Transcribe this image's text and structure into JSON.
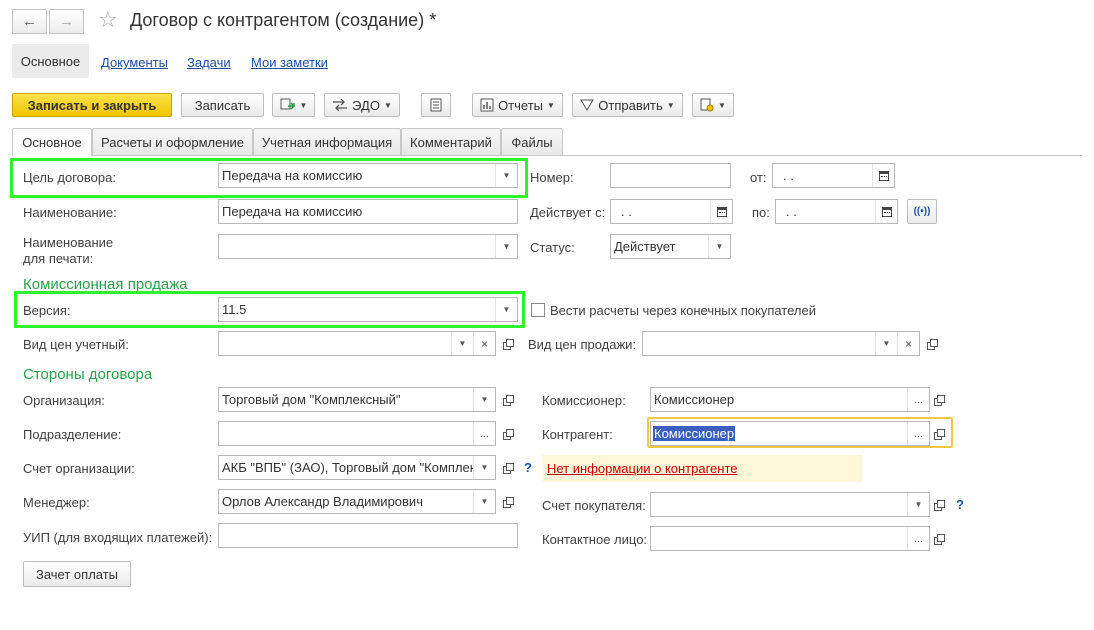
{
  "window": {
    "title": "Договор с контрагентом (создание) *"
  },
  "topnav": {
    "main": "Основное",
    "documents": "Документы",
    "tasks": "Задачи",
    "notes": "Мои заметки"
  },
  "toolbar": {
    "save_close": "Записать и закрыть",
    "save": "Записать",
    "edo": "ЭДО",
    "reports": "Отчеты",
    "send": "Отправить"
  },
  "tabs": [
    "Основное",
    "Расчеты и оформление",
    "Учетная информация",
    "Комментарий",
    "Файлы"
  ],
  "form": {
    "purpose_label": "Цель договора:",
    "purpose_value": "Передача на комиссию",
    "name_label": "Наименование:",
    "name_value": "Передача на комиссию",
    "print_name_label_1": "Наименование",
    "print_name_label_2": "для печати:",
    "print_name_value": "",
    "number_label": "Номер:",
    "number_value": "",
    "from_label": "от:",
    "from_value": " .  .",
    "valid_label": "Действует с:",
    "valid_value": " .  .",
    "to_label": "по:",
    "to_value": " .  .",
    "status_label": "Статус:",
    "status_value": "Действует",
    "section_commission": "Комиссионная продажа",
    "version_label": "Версия:",
    "version_value": "11.5",
    "final_buyers_label": "Вести расчеты через конечных покупателей",
    "price_type_label": "Вид цен учетный:",
    "price_type_value": "",
    "sale_price_label": "Вид цен продажи:",
    "sale_price_value": "",
    "section_parties": "Стороны договора",
    "org_label": "Организация:",
    "org_value": "Торговый дом \"Комплексный\"",
    "dept_label": "Подразделение:",
    "dept_value": "",
    "account_label": "Счет организации:",
    "account_value": "АКБ \"ВПБ\" (ЗАО), Торговый дом \"Комплексный\"",
    "manager_label": "Менеджер:",
    "manager_value": "Орлов Александр Владимирович",
    "uip_label": "УИП (для входящих платежей):",
    "uip_value": "",
    "commissioner_label": "Комиссионер:",
    "commissioner_value": "Комиссионер",
    "counterparty_label": "Контрагент:",
    "counterparty_value": "Комиссионер",
    "no_info": "Нет информации о контрагенте",
    "buyer_account_label": "Счет покупателя:",
    "buyer_account_value": "",
    "contact_label": "Контактное лицо:",
    "contact_value": "",
    "offset_button": "Зачет оплаты",
    "help_mark": "?"
  },
  "colors": {
    "accent_yellow": "#f5d20d",
    "highlight_green": "#2ef22e",
    "section_green": "#2aa24a",
    "link_blue": "#1d4ea2"
  }
}
